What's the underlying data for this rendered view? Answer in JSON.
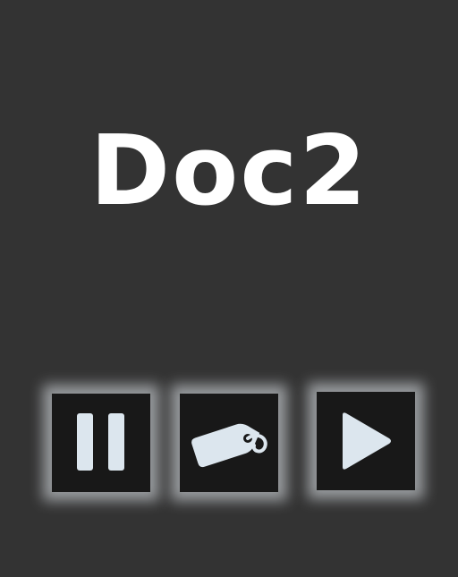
{
  "title": "Doc2",
  "controls": [
    {
      "id": "pause",
      "icon": "pause-icon"
    },
    {
      "id": "tag",
      "icon": "tag-icon"
    },
    {
      "id": "play",
      "icon": "play-icon"
    }
  ],
  "colors": {
    "background": "#333333",
    "button_bg": "#181818",
    "icon": "#dce6ee",
    "title": "#ffffff"
  }
}
